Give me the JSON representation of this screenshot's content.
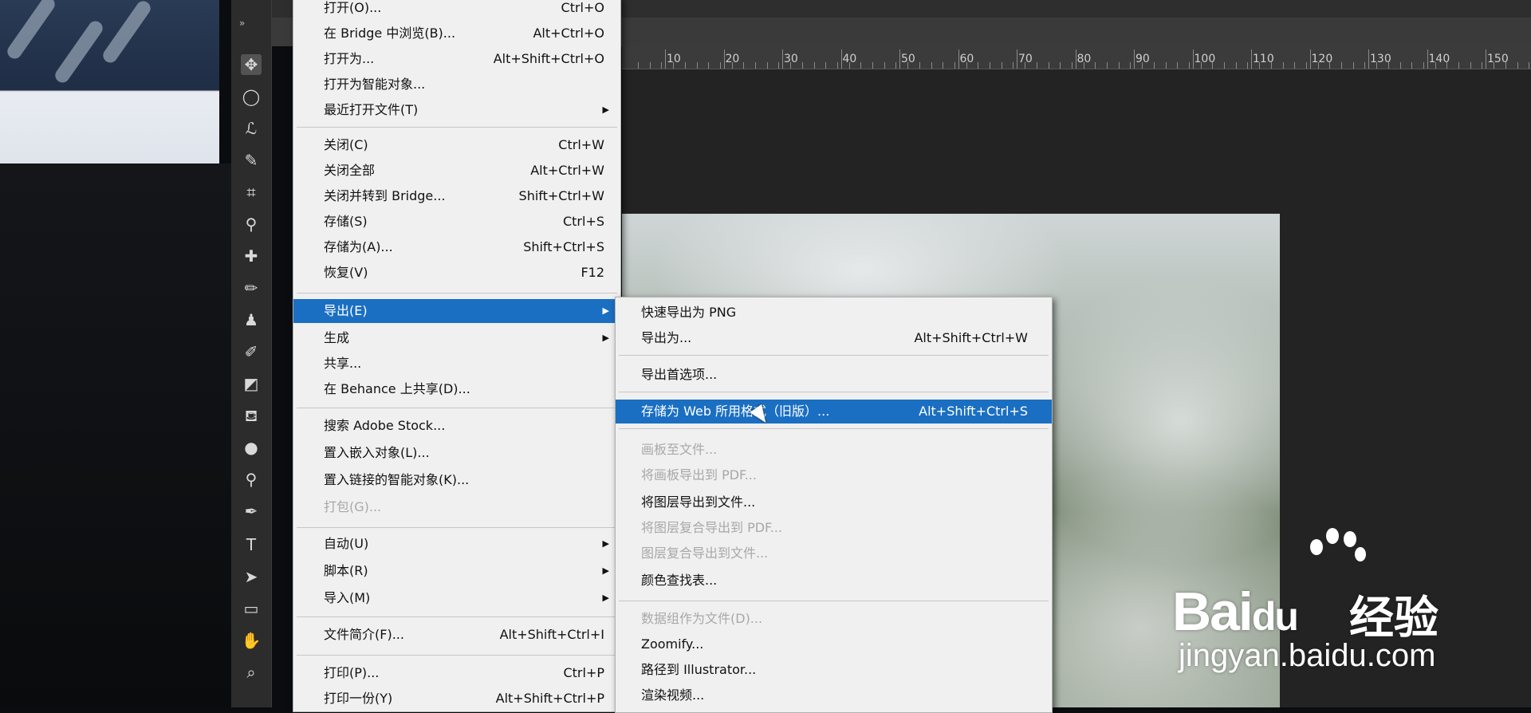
{
  "ruler_ticks": [
    "10",
    "20",
    "30",
    "40",
    "50",
    "60",
    "70",
    "80",
    "90",
    "100",
    "110",
    "120",
    "130",
    "140",
    "150"
  ],
  "tools": [
    "move-icon",
    "marquee-icon",
    "lasso-icon",
    "quick-select-icon",
    "crop-icon",
    "eyedropper-icon",
    "healing-icon",
    "brush-icon",
    "stamp-icon",
    "history-brush-icon",
    "eraser-icon",
    "paint-bucket-icon",
    "blur-icon",
    "dodge-icon",
    "pen-icon",
    "type-icon",
    "path-select-icon",
    "rectangle-icon",
    "hand-icon",
    "zoom-icon"
  ],
  "file_menu": {
    "items": [
      {
        "label": "打开(O)...",
        "shortcut": "Ctrl+O"
      },
      {
        "label": "在 Bridge 中浏览(B)...",
        "shortcut": "Alt+Ctrl+O"
      },
      {
        "label": "打开为...",
        "shortcut": "Alt+Shift+Ctrl+O"
      },
      {
        "label": "打开为智能对象...",
        "shortcut": ""
      },
      {
        "label": "最近打开文件(T)",
        "shortcut": "",
        "submenu": true
      },
      {
        "label": "关闭(C)",
        "shortcut": "Ctrl+W"
      },
      {
        "label": "关闭全部",
        "shortcut": "Alt+Ctrl+W"
      },
      {
        "label": "关闭并转到 Bridge...",
        "shortcut": "Shift+Ctrl+W"
      },
      {
        "label": "存储(S)",
        "shortcut": "Ctrl+S"
      },
      {
        "label": "存储为(A)...",
        "shortcut": "Shift+Ctrl+S"
      },
      {
        "label": "恢复(V)",
        "shortcut": "F12"
      },
      {
        "label": "导出(E)",
        "shortcut": "",
        "submenu": true,
        "highlighted": true
      },
      {
        "label": "生成",
        "shortcut": "",
        "submenu": true
      },
      {
        "label": "共享...",
        "shortcut": ""
      },
      {
        "label": "在 Behance 上共享(D)...",
        "shortcut": ""
      },
      {
        "label": "搜索 Adobe Stock...",
        "shortcut": ""
      },
      {
        "label": "置入嵌入对象(L)...",
        "shortcut": ""
      },
      {
        "label": "置入链接的智能对象(K)...",
        "shortcut": ""
      },
      {
        "label": "打包(G)...",
        "shortcut": "",
        "disabled": true
      },
      {
        "label": "自动(U)",
        "shortcut": "",
        "submenu": true
      },
      {
        "label": "脚本(R)",
        "shortcut": "",
        "submenu": true
      },
      {
        "label": "导入(M)",
        "shortcut": "",
        "submenu": true
      },
      {
        "label": "文件简介(F)...",
        "shortcut": "Alt+Shift+Ctrl+I"
      },
      {
        "label": "打印(P)...",
        "shortcut": "Ctrl+P"
      },
      {
        "label": "打印一份(Y)",
        "shortcut": "Alt+Shift+Ctrl+P"
      }
    ]
  },
  "export_menu": {
    "items": [
      {
        "label": "快速导出为 PNG",
        "shortcut": ""
      },
      {
        "label": "导出为...",
        "shortcut": "Alt+Shift+Ctrl+W"
      },
      {
        "label": "导出首选项...",
        "shortcut": ""
      },
      {
        "label": "存储为 Web 所用格式（旧版）...",
        "shortcut": "Alt+Shift+Ctrl+S",
        "highlighted": true
      },
      {
        "label": "画板至文件...",
        "shortcut": "",
        "disabled": true
      },
      {
        "label": "将画板导出到 PDF...",
        "shortcut": "",
        "disabled": true
      },
      {
        "label": "将图层导出到文件...",
        "shortcut": ""
      },
      {
        "label": "将图层复合导出到 PDF...",
        "shortcut": "",
        "disabled": true
      },
      {
        "label": "图层复合导出到文件...",
        "shortcut": "",
        "disabled": true
      },
      {
        "label": "颜色查找表...",
        "shortcut": ""
      },
      {
        "label": "数据组作为文件(D)...",
        "shortcut": "",
        "disabled": true
      },
      {
        "label": "Zoomify...",
        "shortcut": ""
      },
      {
        "label": "路径到 Illustrator...",
        "shortcut": ""
      },
      {
        "label": "渲染视频...",
        "shortcut": ""
      }
    ]
  },
  "watermark": {
    "brand": "Bai",
    "brand_suffix": "du",
    "jingyan": "经验",
    "url": "jingyan.baidu.com"
  },
  "colors": {
    "highlight": "#1a6fc2",
    "menu_bg": "#f0f0f0",
    "disabled": "#a8a8a8"
  }
}
